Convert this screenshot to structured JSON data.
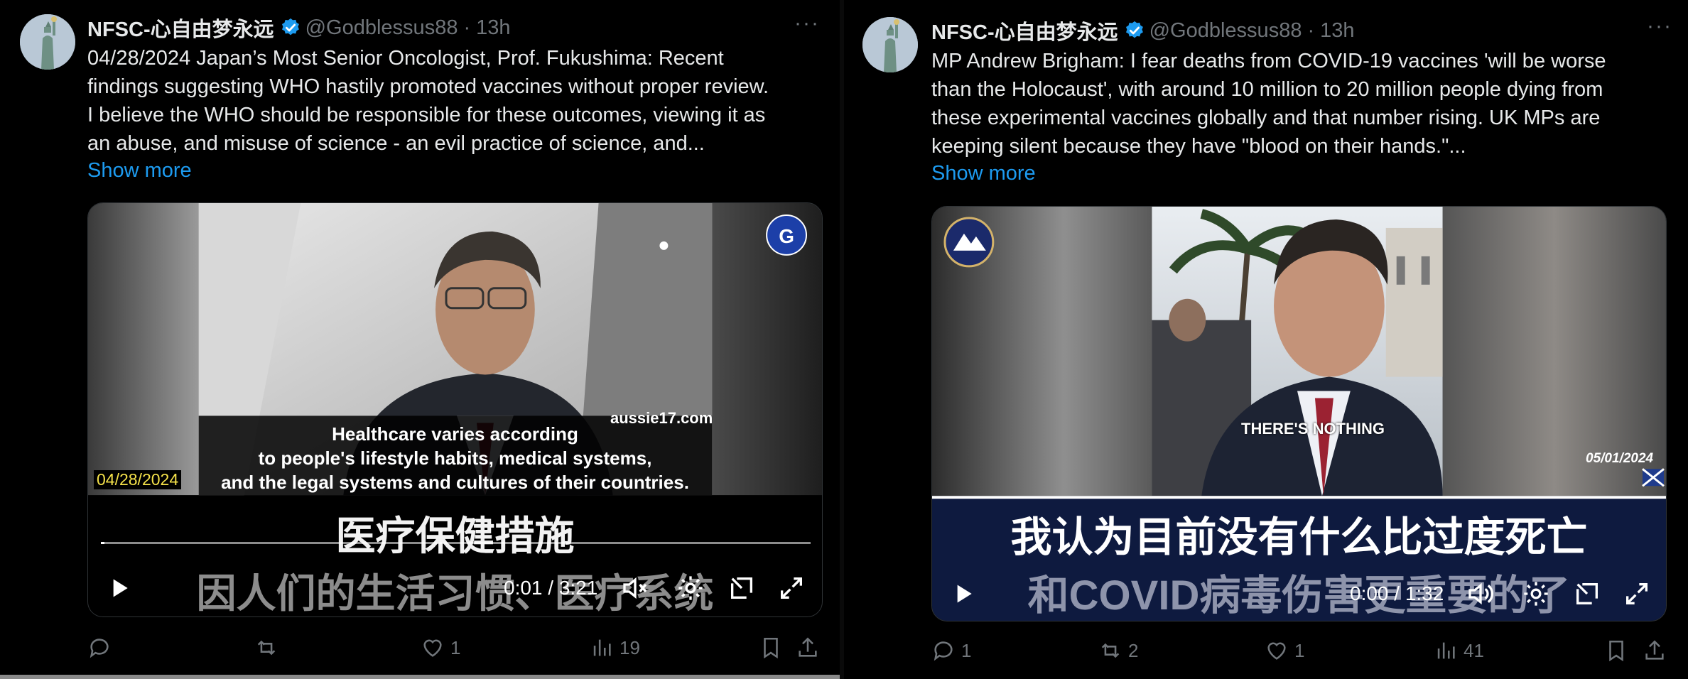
{
  "tweets": [
    {
      "author_name": "NFSC-心自由梦永远",
      "handle": "@Godblessus88",
      "time": "13h",
      "text": "04/28/2024 Japan’s Most Senior Oncologist, Prof. Fukushima: Recent\nfindings suggesting WHO hastily promoted vaccines without proper review.\nI believe the WHO should be responsible for these outcomes, viewing it as\nan abuse, and misuse of science - an evil practice of science, and...",
      "show_more": "Show more",
      "video": {
        "watermark": "aussie17.com",
        "date_overlay": "04/28/2024",
        "caption_en_1": "Healthcare varies according",
        "caption_en_2": "to people's lifestyle habits, medical systems,",
        "caption_en_3": "and the legal systems and cultures of their countries.",
        "caption_zh_1": "医疗保健措施",
        "caption_zh_2": "因人们的生活习惯、医疗系统",
        "time_readout": "0:01 / 3:21",
        "progress_fraction": 0.005
      },
      "replies": "",
      "reposts": "",
      "likes": "1",
      "views": "19"
    },
    {
      "author_name": "NFSC-心自由梦永远",
      "handle": "@Godblessus88",
      "time": "13h",
      "text": "MP Andrew Brigham: I fear deaths from COVID-19 vaccines 'will be worse\nthan the Holocaust', with around 10 million to 20 million people dying from\nthese experimental vaccines globally and that number rising. UK MPs are\nkeeping silent because they have \"blood on their hands.\"...",
      "show_more": "Show more",
      "video": {
        "caption_en": "THERE'S NOTHING",
        "date_overlay": "05/01/2024",
        "caption_zh_1": "我认为目前没有什么比过度死亡",
        "caption_zh_2": "和COVID病毒伤害更重要的了",
        "time_readout": "0:00 / 1:32"
      },
      "replies": "1",
      "reposts": "2",
      "likes": "1",
      "views": "41"
    }
  ],
  "colors": {
    "background": "#000000",
    "text": "#e7e9ea",
    "muted": "#71767b",
    "link": "#1d9bf0",
    "verified": "#1d9bf0"
  }
}
